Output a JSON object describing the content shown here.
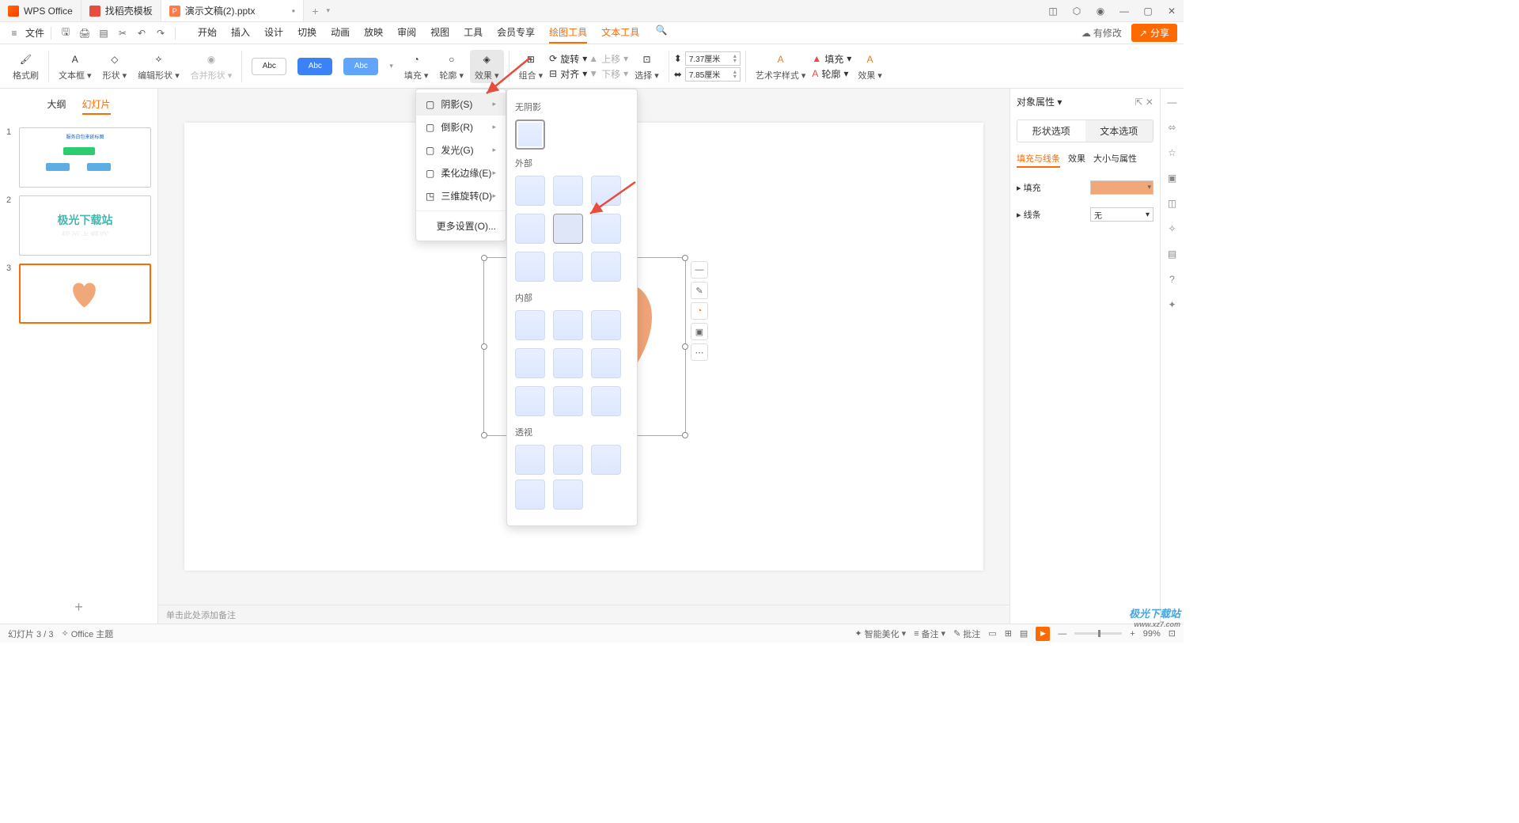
{
  "titlebar": {
    "tabs": [
      {
        "icon": "wps",
        "label": "WPS Office"
      },
      {
        "icon": "doc",
        "label": "找稻壳模板"
      },
      {
        "icon": "ppt",
        "label": "演示文稿(2).pptx",
        "active": true,
        "dot": "●"
      }
    ],
    "plus": "+"
  },
  "menubar": {
    "file": "文件",
    "modify": "有修改",
    "share": "分享",
    "tabs": [
      "开始",
      "插入",
      "设计",
      "切换",
      "动画",
      "放映",
      "审阅",
      "视图",
      "工具",
      "会员专享",
      "绘图工具",
      "文本工具"
    ]
  },
  "ribbon": {
    "format_painter": "格式刷",
    "textbox": "文本框",
    "shape": "形状",
    "edit_shape": "编辑形状",
    "merge_shape": "合并形状",
    "style_label": "Abc",
    "fill": "填充",
    "outline": "轮廓",
    "effect": "效果",
    "group": "组合",
    "rotate": "旋转",
    "align": "对齐",
    "up": "上移",
    "down": "下移",
    "select": "选择",
    "width": "7.37厘米",
    "height": "7.85厘米",
    "art_style": "艺术字样式",
    "t_fill": "填充",
    "t_outline": "轮廓",
    "t_effect": "效果"
  },
  "side": {
    "outline": "大纲",
    "slides": "幻灯片",
    "slides_list": [
      "1",
      "2",
      "3"
    ],
    "thumb2": "极光下载站"
  },
  "effect_menu": {
    "items": [
      {
        "label": "阴影(S)",
        "hk": ""
      },
      {
        "label": "倒影(R)",
        "hk": ""
      },
      {
        "label": "发光(G)",
        "hk": ""
      },
      {
        "label": "柔化边缘(E)",
        "hk": ""
      },
      {
        "label": "三维旋转(D)",
        "hk": ""
      }
    ],
    "more": "更多设置(O)..."
  },
  "shadow_panel": {
    "none": "无阴影",
    "outer": "外部",
    "inner": "内部",
    "perspective": "透视"
  },
  "right_panel": {
    "title": "对象属性",
    "tab_shape": "形状选项",
    "tab_text": "文本选项",
    "sub": [
      "填充与线条",
      "效果",
      "大小与属性"
    ],
    "fill": "填充",
    "line": "线条",
    "line_val": "无"
  },
  "notes": "单击此处添加备注",
  "statusbar": {
    "slide_info": "幻灯片 3 / 3",
    "theme": "Office 主题",
    "smart": "智能美化",
    "notes_btn": "备注",
    "comment": "批注",
    "zoom": "99%"
  },
  "watermark": {
    "main": "极光下载站",
    "sub": "www.xz7.com"
  }
}
